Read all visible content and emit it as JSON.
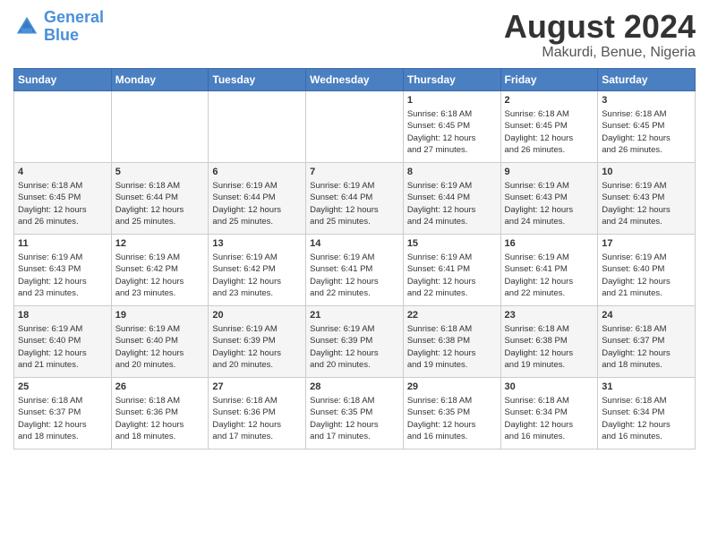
{
  "header": {
    "logo_line1": "General",
    "logo_line2": "Blue",
    "month_year": "August 2024",
    "location": "Makurdi, Benue, Nigeria"
  },
  "days_of_week": [
    "Sunday",
    "Monday",
    "Tuesday",
    "Wednesday",
    "Thursday",
    "Friday",
    "Saturday"
  ],
  "weeks": [
    [
      {
        "day": "",
        "info": ""
      },
      {
        "day": "",
        "info": ""
      },
      {
        "day": "",
        "info": ""
      },
      {
        "day": "",
        "info": ""
      },
      {
        "day": "1",
        "info": "Sunrise: 6:18 AM\nSunset: 6:45 PM\nDaylight: 12 hours\nand 27 minutes."
      },
      {
        "day": "2",
        "info": "Sunrise: 6:18 AM\nSunset: 6:45 PM\nDaylight: 12 hours\nand 26 minutes."
      },
      {
        "day": "3",
        "info": "Sunrise: 6:18 AM\nSunset: 6:45 PM\nDaylight: 12 hours\nand 26 minutes."
      }
    ],
    [
      {
        "day": "4",
        "info": "Sunrise: 6:18 AM\nSunset: 6:45 PM\nDaylight: 12 hours\nand 26 minutes."
      },
      {
        "day": "5",
        "info": "Sunrise: 6:18 AM\nSunset: 6:44 PM\nDaylight: 12 hours\nand 25 minutes."
      },
      {
        "day": "6",
        "info": "Sunrise: 6:19 AM\nSunset: 6:44 PM\nDaylight: 12 hours\nand 25 minutes."
      },
      {
        "day": "7",
        "info": "Sunrise: 6:19 AM\nSunset: 6:44 PM\nDaylight: 12 hours\nand 25 minutes."
      },
      {
        "day": "8",
        "info": "Sunrise: 6:19 AM\nSunset: 6:44 PM\nDaylight: 12 hours\nand 24 minutes."
      },
      {
        "day": "9",
        "info": "Sunrise: 6:19 AM\nSunset: 6:43 PM\nDaylight: 12 hours\nand 24 minutes."
      },
      {
        "day": "10",
        "info": "Sunrise: 6:19 AM\nSunset: 6:43 PM\nDaylight: 12 hours\nand 24 minutes."
      }
    ],
    [
      {
        "day": "11",
        "info": "Sunrise: 6:19 AM\nSunset: 6:43 PM\nDaylight: 12 hours\nand 23 minutes."
      },
      {
        "day": "12",
        "info": "Sunrise: 6:19 AM\nSunset: 6:42 PM\nDaylight: 12 hours\nand 23 minutes."
      },
      {
        "day": "13",
        "info": "Sunrise: 6:19 AM\nSunset: 6:42 PM\nDaylight: 12 hours\nand 23 minutes."
      },
      {
        "day": "14",
        "info": "Sunrise: 6:19 AM\nSunset: 6:41 PM\nDaylight: 12 hours\nand 22 minutes."
      },
      {
        "day": "15",
        "info": "Sunrise: 6:19 AM\nSunset: 6:41 PM\nDaylight: 12 hours\nand 22 minutes."
      },
      {
        "day": "16",
        "info": "Sunrise: 6:19 AM\nSunset: 6:41 PM\nDaylight: 12 hours\nand 22 minutes."
      },
      {
        "day": "17",
        "info": "Sunrise: 6:19 AM\nSunset: 6:40 PM\nDaylight: 12 hours\nand 21 minutes."
      }
    ],
    [
      {
        "day": "18",
        "info": "Sunrise: 6:19 AM\nSunset: 6:40 PM\nDaylight: 12 hours\nand 21 minutes."
      },
      {
        "day": "19",
        "info": "Sunrise: 6:19 AM\nSunset: 6:40 PM\nDaylight: 12 hours\nand 20 minutes."
      },
      {
        "day": "20",
        "info": "Sunrise: 6:19 AM\nSunset: 6:39 PM\nDaylight: 12 hours\nand 20 minutes."
      },
      {
        "day": "21",
        "info": "Sunrise: 6:19 AM\nSunset: 6:39 PM\nDaylight: 12 hours\nand 20 minutes."
      },
      {
        "day": "22",
        "info": "Sunrise: 6:18 AM\nSunset: 6:38 PM\nDaylight: 12 hours\nand 19 minutes."
      },
      {
        "day": "23",
        "info": "Sunrise: 6:18 AM\nSunset: 6:38 PM\nDaylight: 12 hours\nand 19 minutes."
      },
      {
        "day": "24",
        "info": "Sunrise: 6:18 AM\nSunset: 6:37 PM\nDaylight: 12 hours\nand 18 minutes."
      }
    ],
    [
      {
        "day": "25",
        "info": "Sunrise: 6:18 AM\nSunset: 6:37 PM\nDaylight: 12 hours\nand 18 minutes."
      },
      {
        "day": "26",
        "info": "Sunrise: 6:18 AM\nSunset: 6:36 PM\nDaylight: 12 hours\nand 18 minutes."
      },
      {
        "day": "27",
        "info": "Sunrise: 6:18 AM\nSunset: 6:36 PM\nDaylight: 12 hours\nand 17 minutes."
      },
      {
        "day": "28",
        "info": "Sunrise: 6:18 AM\nSunset: 6:35 PM\nDaylight: 12 hours\nand 17 minutes."
      },
      {
        "day": "29",
        "info": "Sunrise: 6:18 AM\nSunset: 6:35 PM\nDaylight: 12 hours\nand 16 minutes."
      },
      {
        "day": "30",
        "info": "Sunrise: 6:18 AM\nSunset: 6:34 PM\nDaylight: 12 hours\nand 16 minutes."
      },
      {
        "day": "31",
        "info": "Sunrise: 6:18 AM\nSunset: 6:34 PM\nDaylight: 12 hours\nand 16 minutes."
      }
    ]
  ]
}
